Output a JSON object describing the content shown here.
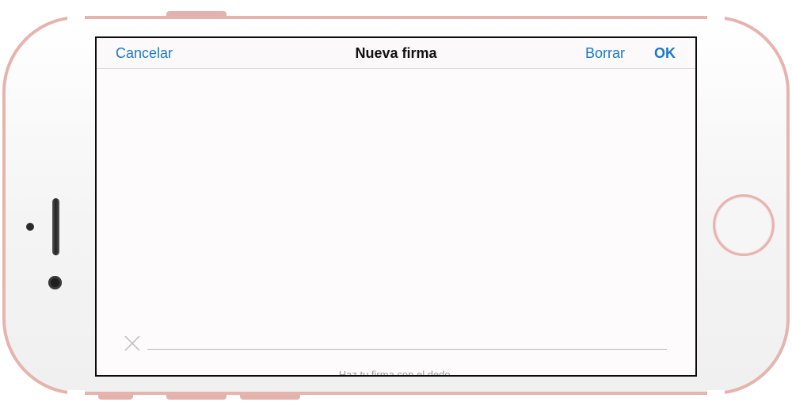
{
  "navbar": {
    "cancel_label": "Cancelar",
    "title": "Nueva firma",
    "clear_label": "Borrar",
    "ok_label": "OK"
  },
  "signature": {
    "hint": "Haz tu firma con el dedo."
  },
  "colors": {
    "accent": "#1b79c6",
    "phone_body": "#e6b4af"
  },
  "icons": [
    "x-mark-icon"
  ]
}
